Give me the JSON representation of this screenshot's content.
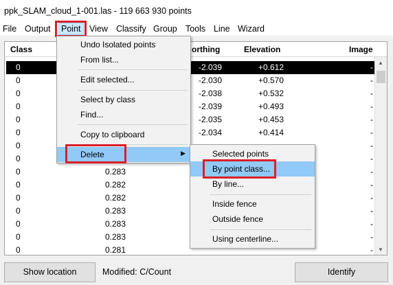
{
  "window": {
    "title": "ppk_SLAM_cloud_1-001.las - 119 663 930 points"
  },
  "menubar": [
    "File",
    "Output",
    "Point",
    "View",
    "Classify",
    "Group",
    "Tools",
    "Line",
    "Wizard"
  ],
  "table": {
    "headers": {
      "class": "Class",
      "northing": "orthing",
      "elevation": "Elevation",
      "image": "Image"
    },
    "rows": [
      {
        "class": "0",
        "easting": "",
        "northing": "-2.039",
        "elevation": "+0.612",
        "image": "-"
      },
      {
        "class": "0",
        "easting": "",
        "northing": "-2.030",
        "elevation": "+0.570",
        "image": "-"
      },
      {
        "class": "0",
        "easting": "",
        "northing": "-2.038",
        "elevation": "+0.532",
        "image": "-"
      },
      {
        "class": "0",
        "easting": "",
        "northing": "-2.039",
        "elevation": "+0.493",
        "image": "-"
      },
      {
        "class": "0",
        "easting": "",
        "northing": "-2.035",
        "elevation": "+0.453",
        "image": "-"
      },
      {
        "class": "0",
        "easting": "",
        "northing": "-2.034",
        "elevation": "+0.414",
        "image": "-"
      },
      {
        "class": "0",
        "easting": "",
        "northing": "",
        "elevation": "",
        "image": "-"
      },
      {
        "class": "0",
        "easting": "",
        "northing": "",
        "elevation": "",
        "image": "-"
      },
      {
        "class": "0",
        "easting": "0.283",
        "northing": "",
        "elevation": "",
        "image": "-"
      },
      {
        "class": "0",
        "easting": "0.282",
        "northing": "",
        "elevation": "",
        "image": "-"
      },
      {
        "class": "0",
        "easting": "0.282",
        "northing": "",
        "elevation": "",
        "image": "-"
      },
      {
        "class": "0",
        "easting": "0.283",
        "northing": "",
        "elevation": "",
        "image": "-"
      },
      {
        "class": "0",
        "easting": "0.283",
        "northing": "",
        "elevation": "",
        "image": "-"
      },
      {
        "class": "0",
        "easting": "0.283",
        "northing": "",
        "elevation": "",
        "image": "-"
      },
      {
        "class": "0",
        "easting": "0.281",
        "northing": "",
        "elevation": "",
        "image": "-"
      }
    ]
  },
  "point_menu": {
    "items": [
      "Undo Isolated points",
      "From list...",
      "Edit selected...",
      "Select by class",
      "Find...",
      "Copy to clipboard",
      "Delete"
    ]
  },
  "delete_submenu": {
    "items": [
      "Selected points",
      "By point class...",
      "By line...",
      "Inside fence",
      "Outside fence",
      "Using centerline..."
    ]
  },
  "bottom": {
    "show_location": "Show location",
    "status": "Modified: C/Count",
    "identify": "Identify"
  },
  "colors": {
    "highlight": "#91c9f7",
    "annotation_red": "#d9202a",
    "selected_row": "#000000"
  }
}
